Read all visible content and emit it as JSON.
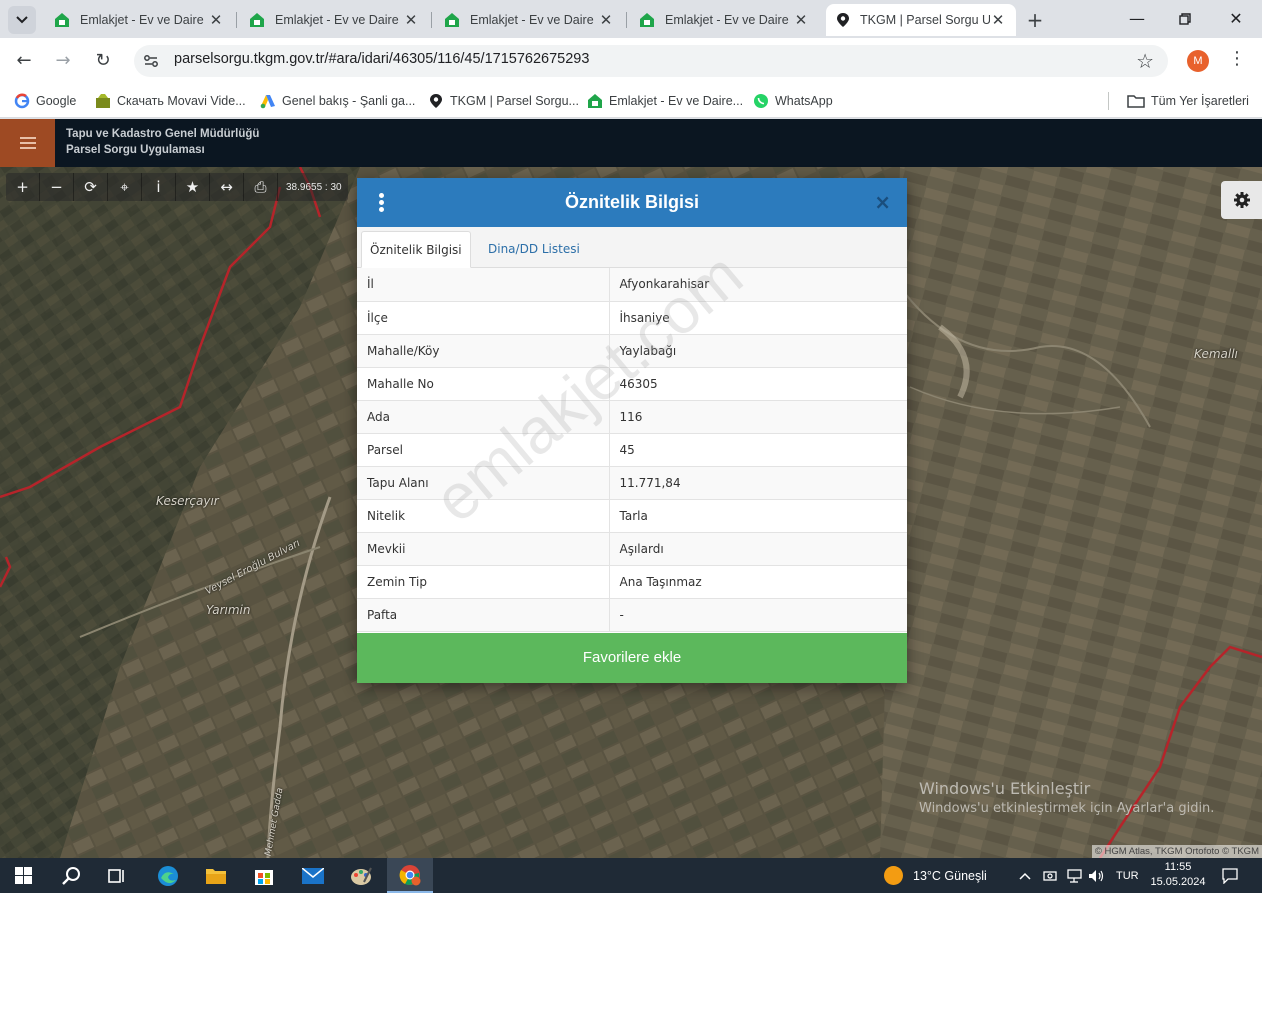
{
  "browser": {
    "tabs": [
      {
        "title": "Emlakjet - Ev ve Daire",
        "icon": "emlakjet-house-icon"
      },
      {
        "title": "Emlakjet - Ev ve Daire",
        "icon": "emlakjet-house-icon"
      },
      {
        "title": "Emlakjet - Ev ve Daire",
        "icon": "emlakjet-house-icon"
      },
      {
        "title": "Emlakjet - Ev ve Daire",
        "icon": "emlakjet-house-icon"
      },
      {
        "title": "TKGM | Parsel Sorgu U",
        "icon": "map-pin-icon",
        "active": true
      }
    ],
    "url": "parselsorgu.tkgm.gov.tr/#ara/idari/46305/116/45/1715762675293",
    "profile_initial": "M",
    "bookmarks": [
      {
        "label": "Google",
        "icon": "google-icon"
      },
      {
        "label": "Скачать Movavi Vide...",
        "icon": "movavi-icon"
      },
      {
        "label": "Genel bakış - Şanli ga...",
        "icon": "google-ads-icon"
      },
      {
        "label": "TKGM | Parsel Sorgu...",
        "icon": "map-pin-icon"
      },
      {
        "label": "Emlakjet - Ev ve Daire...",
        "icon": "emlakjet-house-icon"
      },
      {
        "label": "WhatsApp",
        "icon": "whatsapp-icon"
      }
    ],
    "all_bookmarks_label": "Tüm Yer İşaretleri"
  },
  "app": {
    "title_line1": "Tapu ve Kadastro Genel Müdürlüğü",
    "title_line2": "Parsel Sorgu Uygulaması",
    "coords_text": "38.9655 : 30"
  },
  "map": {
    "labels": [
      "Keserçayır",
      "Yarımin",
      "Veysel Eroğlu Bulvarı",
      "Kemallı",
      "Mehmet Gadda"
    ],
    "windows_watermark_line1": "Windows'u Etkinleştir",
    "windows_watermark_line2": "Windows'u etkinleştirmek için Ayarlar'a gidin.",
    "attribution": "© HGM Atlas, TKGM Ortofoto © TKGM"
  },
  "modal": {
    "title": "Öznitelik Bilgisi",
    "tabs": [
      "Öznitelik Bilgisi",
      "Dina/DD Listesi"
    ],
    "rows": [
      {
        "key": "İl",
        "value": "Afyonkarahisar"
      },
      {
        "key": "İlçe",
        "value": "İhsaniye"
      },
      {
        "key": "Mahalle/Köy",
        "value": "Yaylabağı"
      },
      {
        "key": "Mahalle No",
        "value": "46305"
      },
      {
        "key": "Ada",
        "value": "116"
      },
      {
        "key": "Parsel",
        "value": "45"
      },
      {
        "key": "Tapu Alanı",
        "value": "11.771,84"
      },
      {
        "key": "Nitelik",
        "value": "Tarla"
      },
      {
        "key": "Mevkii",
        "value": "Aşılardı"
      },
      {
        "key": "Zemin Tip",
        "value": "Ana Taşınmaz"
      },
      {
        "key": "Pafta",
        "value": "-"
      }
    ],
    "favorite_button": "Favorilere ekle",
    "watermark": "emlakjet.com"
  },
  "taskbar": {
    "weather": "13°C  Güneşli",
    "language": "TUR",
    "time": "11:55",
    "date": "15.05.2024"
  }
}
